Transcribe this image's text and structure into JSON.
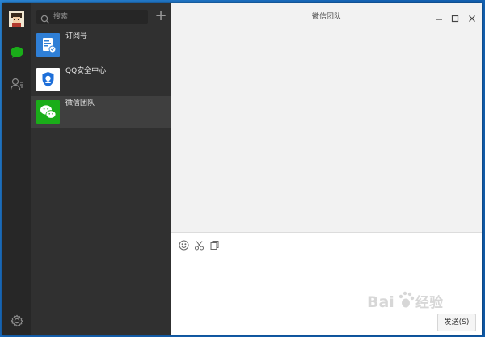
{
  "window": {
    "title": "微信团队"
  },
  "search": {
    "placeholder": "搜索"
  },
  "list": {
    "add_label": "+",
    "items": [
      {
        "label": "订阅号",
        "icon": "subscription-icon",
        "color": "#2f7fd6"
      },
      {
        "label": "QQ安全中心",
        "icon": "qq-security-icon",
        "color": "#ffffff"
      },
      {
        "label": "微信团队",
        "icon": "wechat-team-icon",
        "color": "#1aad19"
      }
    ],
    "active_index": 2
  },
  "rail": {
    "icons": [
      "avatar",
      "chat-icon",
      "contacts-icon",
      "settings-icon"
    ],
    "accent": "#1aad19"
  },
  "composer": {
    "tools": [
      "emoji-icon",
      "scissors-icon",
      "files-icon"
    ],
    "send_label": "发送(S)"
  },
  "watermark": {
    "text": "Bai百经验"
  }
}
